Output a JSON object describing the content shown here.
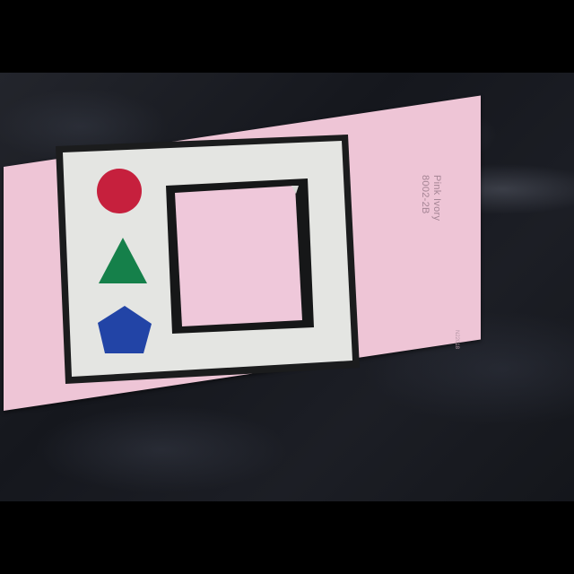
{
  "paint_chip": {
    "name": "Pink Ivory",
    "code": "8002-2B",
    "small_code": "N22018",
    "color": "#eec5d6"
  },
  "card": {
    "background_color": "#e4e5e2",
    "border_color": "#1b1c1d",
    "window_color": "#efc8da"
  },
  "shapes": [
    {
      "shape": "circle",
      "color": "#c6203d"
    },
    {
      "shape": "triangle",
      "color": "#15804a"
    },
    {
      "shape": "pentagon",
      "color": "#2244a6"
    }
  ]
}
